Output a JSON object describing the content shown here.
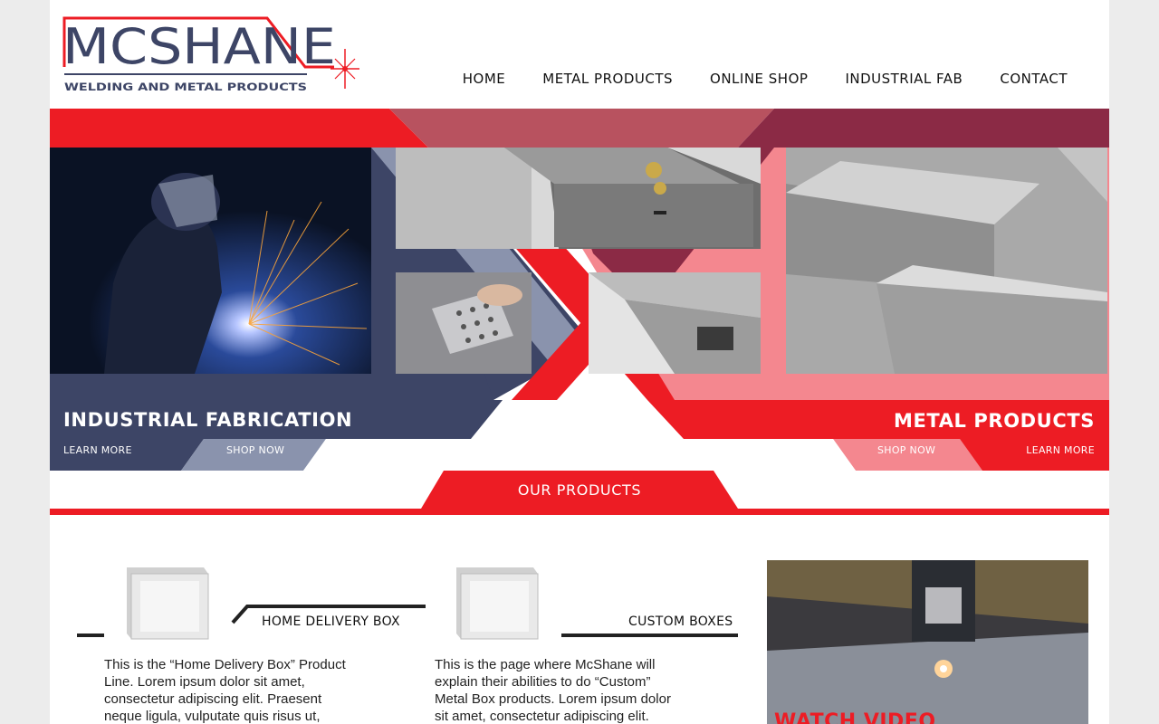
{
  "brand": {
    "name": "MCSHANE",
    "tagline": "WELDING AND METAL PRODUCTS"
  },
  "nav": {
    "items": [
      "HOME",
      "METAL PRODUCTS",
      "ONLINE SHOP",
      "INDUSTRIAL FAB",
      "CONTACT"
    ]
  },
  "hero": {
    "left": {
      "title": "INDUSTRIAL FABRICATION",
      "learn_more": "LEARN MORE",
      "shop_now": "SHOP NOW"
    },
    "right": {
      "title": "METAL PRODUCTS",
      "shop_now": "SHOP NOW",
      "learn_more": "LEARN MORE"
    }
  },
  "products": {
    "heading": "OUR PRODUCTS",
    "items": [
      {
        "name": "HOME DELIVERY BOX",
        "description": "This is the “Home Delivery Box” Product Line. Lorem ipsum dolor sit amet, consectetur adipiscing elit. Praesent neque ligula, vulputate quis risus ut,"
      },
      {
        "name": "CUSTOM BOXES",
        "description": "This is the page where McShane will explain their abilities to do “Custom” Metal Box products. Lorem ipsum dolor sit amet, consectetur adipiscing elit."
      }
    ],
    "video_label": "WATCH VIDEO"
  },
  "colors": {
    "red": "#ed1c24",
    "navy": "#3d4566",
    "maroon": "#8b2a45",
    "pink": "#f4878f",
    "dark_text": "#111111"
  }
}
